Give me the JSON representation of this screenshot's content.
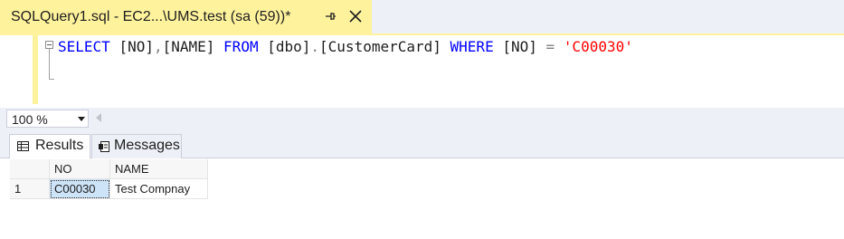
{
  "tab": {
    "title": "SQLQuery1.sql - EC2...\\UMS.test (sa (59))*",
    "pin_icon": "pin-icon",
    "close_icon": "close-icon"
  },
  "editor": {
    "code": {
      "select": "SELECT",
      "col1": "[NO]",
      "comma": ",",
      "col2": "[NAME]",
      "from": "FROM",
      "schema": "[dbo]",
      "dot": ".",
      "table": "[CustomerCard]",
      "where": "WHERE",
      "col3": "[NO]",
      "eq": "=",
      "value": "'C00030'"
    }
  },
  "zoom": {
    "value": "100 %"
  },
  "results_tabs": {
    "results_label": "Results",
    "messages_label": "Messages"
  },
  "grid": {
    "columns": [
      "NO",
      "NAME"
    ],
    "rows": [
      {
        "row_number": "1",
        "NO": "C00030",
        "NAME": "Test Compnay"
      }
    ]
  },
  "colors": {
    "tab_active": "#fff29d",
    "keyword": "#0000ff",
    "string": "#ff0000",
    "operator": "#808080",
    "chrome": "#eef0f8"
  }
}
